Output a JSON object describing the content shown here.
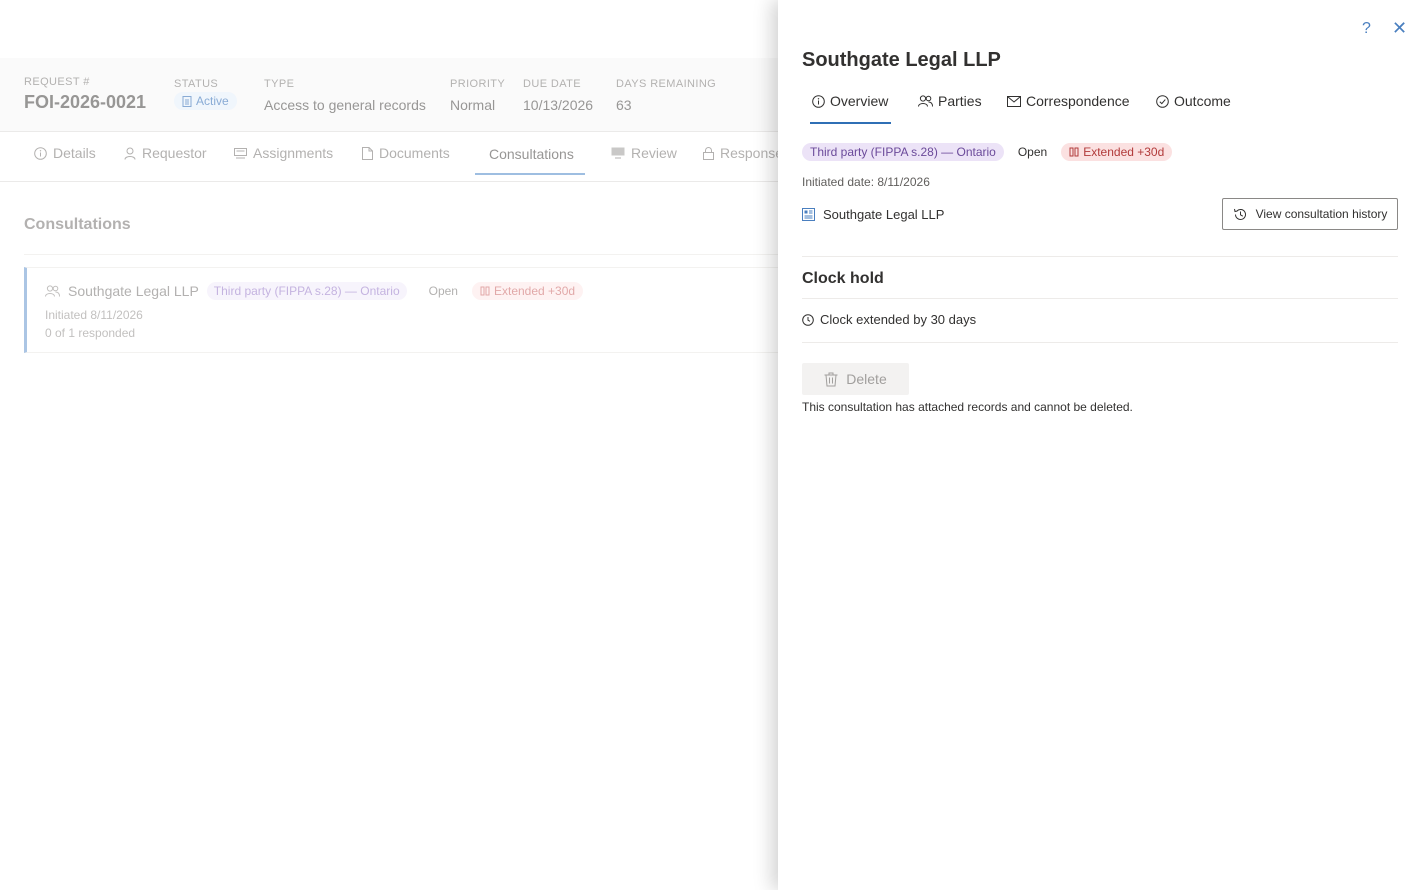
{
  "request_header": {
    "request_label": "REQUEST #",
    "request_value": "FOI-2026-0021",
    "status_label": "STATUS",
    "status_value": "Active",
    "type_label": "TYPE",
    "type_value": "Access to general records",
    "priority_label": "PRIORITY",
    "priority_value": "Normal",
    "due_label": "DUE DATE",
    "due_value": "10/13/2026",
    "days_label": "DAYS REMAINING",
    "days_value": "63"
  },
  "main_tabs": [
    {
      "label": "Details",
      "icon": "info-icon"
    },
    {
      "label": "Requestor",
      "icon": "person-icon"
    },
    {
      "label": "Assignments",
      "icon": "assignments-icon"
    },
    {
      "label": "Documents",
      "icon": "document-icon"
    },
    {
      "label": "Consultations",
      "icon": "",
      "active": true
    },
    {
      "label": "Review",
      "icon": "review-icon"
    },
    {
      "label": "Response",
      "icon": "lock-icon"
    }
  ],
  "consultations": {
    "title": "Consultations",
    "card": {
      "name": "Southgate Legal LLP",
      "type_tag": "Third party (FIPPA s.28) — Ontario",
      "status_tag": "Open",
      "extended_tag": "Extended +30d",
      "initiated": "Initiated 8/11/2026",
      "responded": "0 of 1 responded"
    }
  },
  "panel": {
    "help_glyph": "?",
    "close_glyph": "✕",
    "title": "Southgate Legal LLP",
    "tabs": [
      {
        "label": "Overview",
        "icon": "info-icon",
        "active": true
      },
      {
        "label": "Parties",
        "icon": "people-icon"
      },
      {
        "label": "Correspondence",
        "icon": "mail-icon"
      },
      {
        "label": "Outcome",
        "icon": "check-circle-icon"
      }
    ],
    "type_tag": "Third party (FIPPA s.28) — Ontario",
    "status_tag": "Open",
    "extended_tag": "Extended +30d",
    "initiated_date": "Initiated date: 8/11/2026",
    "party_name": "Southgate Legal LLP",
    "history_button": "View consultation history",
    "clock_hold_title": "Clock hold",
    "clock_line": "Clock extended by 30 days",
    "delete_button": "Delete",
    "delete_note": "This consultation has attached records and cannot be deleted."
  },
  "colors": {
    "accent": "#2f6fb5",
    "purple_tag_bg": "#ece3f7",
    "red_tag_bg": "#fbe1e1"
  }
}
